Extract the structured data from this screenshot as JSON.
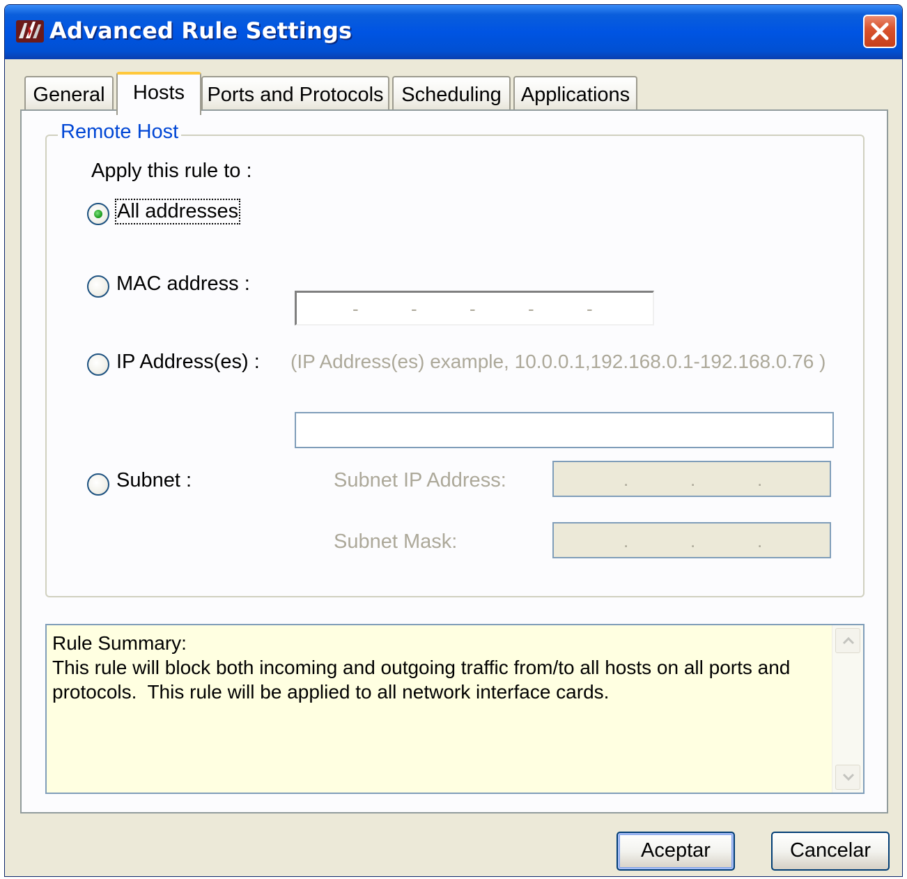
{
  "window": {
    "title": "Advanced Rule Settings"
  },
  "tabs": [
    {
      "label": "General",
      "active": false
    },
    {
      "label": "Hosts",
      "active": true
    },
    {
      "label": "Ports and Protocols",
      "active": false
    },
    {
      "label": "Scheduling",
      "active": false
    },
    {
      "label": "Applications",
      "active": false
    }
  ],
  "remote_host": {
    "group_title": "Remote Host",
    "apply_label": "Apply this rule to :",
    "options": {
      "all": {
        "label": "All addresses",
        "selected": true
      },
      "mac": {
        "label": "MAC address :",
        "selected": false
      },
      "ip": {
        "label": "IP Address(es) :",
        "selected": false
      },
      "subnet": {
        "label": "Subnet :",
        "selected": false
      }
    },
    "mac_value": "",
    "mac_separator": "-",
    "ip_hint": "(IP Address(es) example, 10.0.0.1,192.168.0.1-192.168.0.76 )",
    "ip_value": "",
    "subnet_ip_label": "Subnet IP Address:",
    "subnet_mask_label": "Subnet Mask:",
    "subnet_separator": "."
  },
  "summary": {
    "heading": "Rule Summary:",
    "text": "This rule will block both incoming and outgoing traffic from/to all hosts on all ports and protocols.  This rule will be applied to all network interface cards."
  },
  "buttons": {
    "ok": "Aceptar",
    "cancel": "Cancelar"
  },
  "colors": {
    "titlebar": "#0054E3",
    "dialog_bg": "#ECE9D8",
    "group_title": "#0046D5",
    "summary_bg": "#FFFFE1",
    "active_tab_accent": "#FFC83C"
  },
  "icons": {
    "app": "firewall-app-icon",
    "close": "close-icon",
    "scroll_up": "scroll-up-icon",
    "scroll_down": "scroll-down-icon"
  }
}
